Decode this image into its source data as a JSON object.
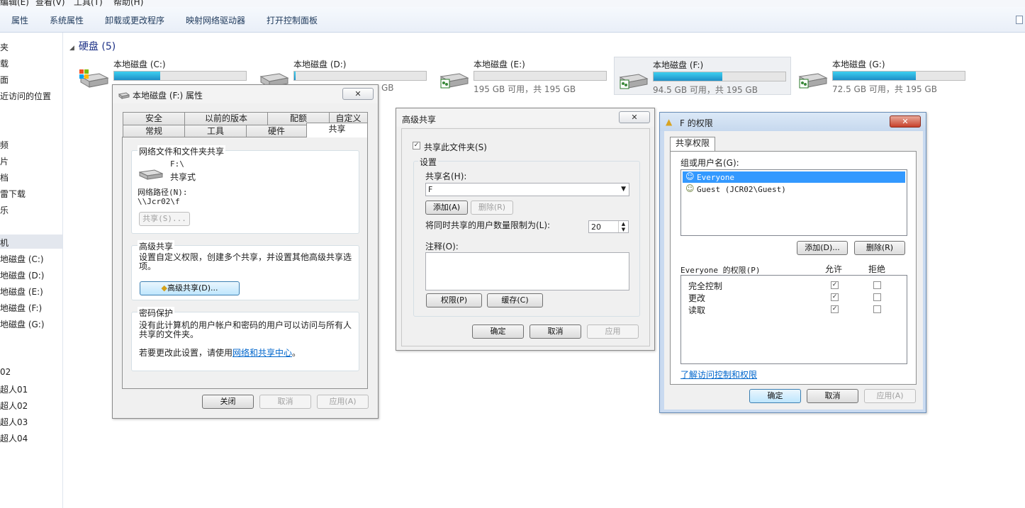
{
  "menubar": {
    "items": [
      "编辑(E)",
      "查看(V)",
      "工具(T)",
      "帮助(H)"
    ]
  },
  "toolbar": {
    "items": [
      "属性",
      "系统属性",
      "卸载或更改程序",
      "映射网络驱动器",
      "打开控制面板"
    ]
  },
  "nav": {
    "items": [
      "夹",
      "载",
      "面",
      "近访问的位置",
      "频",
      "片",
      "档",
      "雷下载",
      "乐",
      "机",
      "地磁盘 (C:)",
      "地磁盘 (D:)",
      "地磁盘 (E:)",
      "地磁盘 (F:)",
      "地磁盘 (G:)",
      "02",
      "超人01",
      "超人02",
      "超人03",
      "超人04"
    ]
  },
  "hard_disks": {
    "title": "硬盘 (5)",
    "drives": [
      {
        "name": "本地磁盘 (C:)",
        "free_text": "",
        "used_fraction": 0.35
      },
      {
        "name": "本地磁盘 (D:)",
        "free_text": "GB",
        "used_fraction": 0.01
      },
      {
        "name": "本地磁盘 (E:)",
        "free_text": "195 GB 可用，共 195 GB",
        "used_fraction": 0.0
      },
      {
        "name": "本地磁盘 (F:)",
        "free_text": "94.5 GB 可用，共 195 GB",
        "used_fraction": 0.52
      },
      {
        "name": "本地磁盘 (G:)",
        "free_text": "72.5 GB 可用，共 195 GB",
        "used_fraction": 0.63
      }
    ]
  },
  "props_dialog": {
    "title": "本地磁盘 (F:) 属性",
    "tabs_back": [
      "安全",
      "以前的版本",
      "配额",
      "自定义"
    ],
    "tabs_front": [
      "常规",
      "工具",
      "硬件",
      "共享"
    ],
    "net_group": "网络文件和文件夹共享",
    "drive_label": "F:\\",
    "share_state": "共享式",
    "net_path_label": "网络路径(N):",
    "net_path": "\\\\Jcr02\\f",
    "share_btn": "共享(S)...",
    "adv_group": "高级共享",
    "adv_desc": "设置自定义权限，创建多个共享，并设置其他高级共享选项。",
    "adv_btn": "高级共享(D)...",
    "pwd_group": "密码保护",
    "pwd_desc": "没有此计算机的用户帐户和密码的用户可以访问与所有人共享的文件夹。",
    "pwd_change_prefix": "若要更改此设置，请使用",
    "pwd_link": "网络和共享中心",
    "pwd_change_suffix": "。",
    "close_btn": "关闭",
    "cancel_btn": "取消",
    "apply_btn": "应用(A)"
  },
  "adv_dialog": {
    "title": "高级共享",
    "share_check": "共享此文件夹(S)",
    "settings_group": "设置",
    "share_name_label": "共享名(H):",
    "share_name": "F",
    "add_btn": "添加(A)",
    "remove_btn": "删除(R)",
    "limit_label": "将同时共享的用户数量限制为(L):",
    "limit_value": "20",
    "comment_label": "注释(O):",
    "perm_btn": "权限(P)",
    "cache_btn": "缓存(C)",
    "ok_btn": "确定",
    "cancel_btn": "取消",
    "apply_btn": "应用"
  },
  "perm_dialog": {
    "title": "F 的权限",
    "tab": "共享权限",
    "users_label": "组或用户名(G):",
    "users": [
      "Everyone",
      "Guest (JCR02\\Guest)"
    ],
    "add_btn": "添加(D)...",
    "remove_btn": "删除(R)",
    "perm_label": "Everyone 的权限(P)",
    "allow_col": "允许",
    "deny_col": "拒绝",
    "perms": [
      {
        "name": "完全控制",
        "allow": "✓",
        "deny": ""
      },
      {
        "name": "更改",
        "allow": "✓",
        "deny": ""
      },
      {
        "name": "读取",
        "allow": "✓",
        "deny": ""
      }
    ],
    "learn_link": "了解访问控制和权限",
    "ok_btn": "确定",
    "cancel_btn": "取消",
    "apply_btn": "应用(A)"
  }
}
